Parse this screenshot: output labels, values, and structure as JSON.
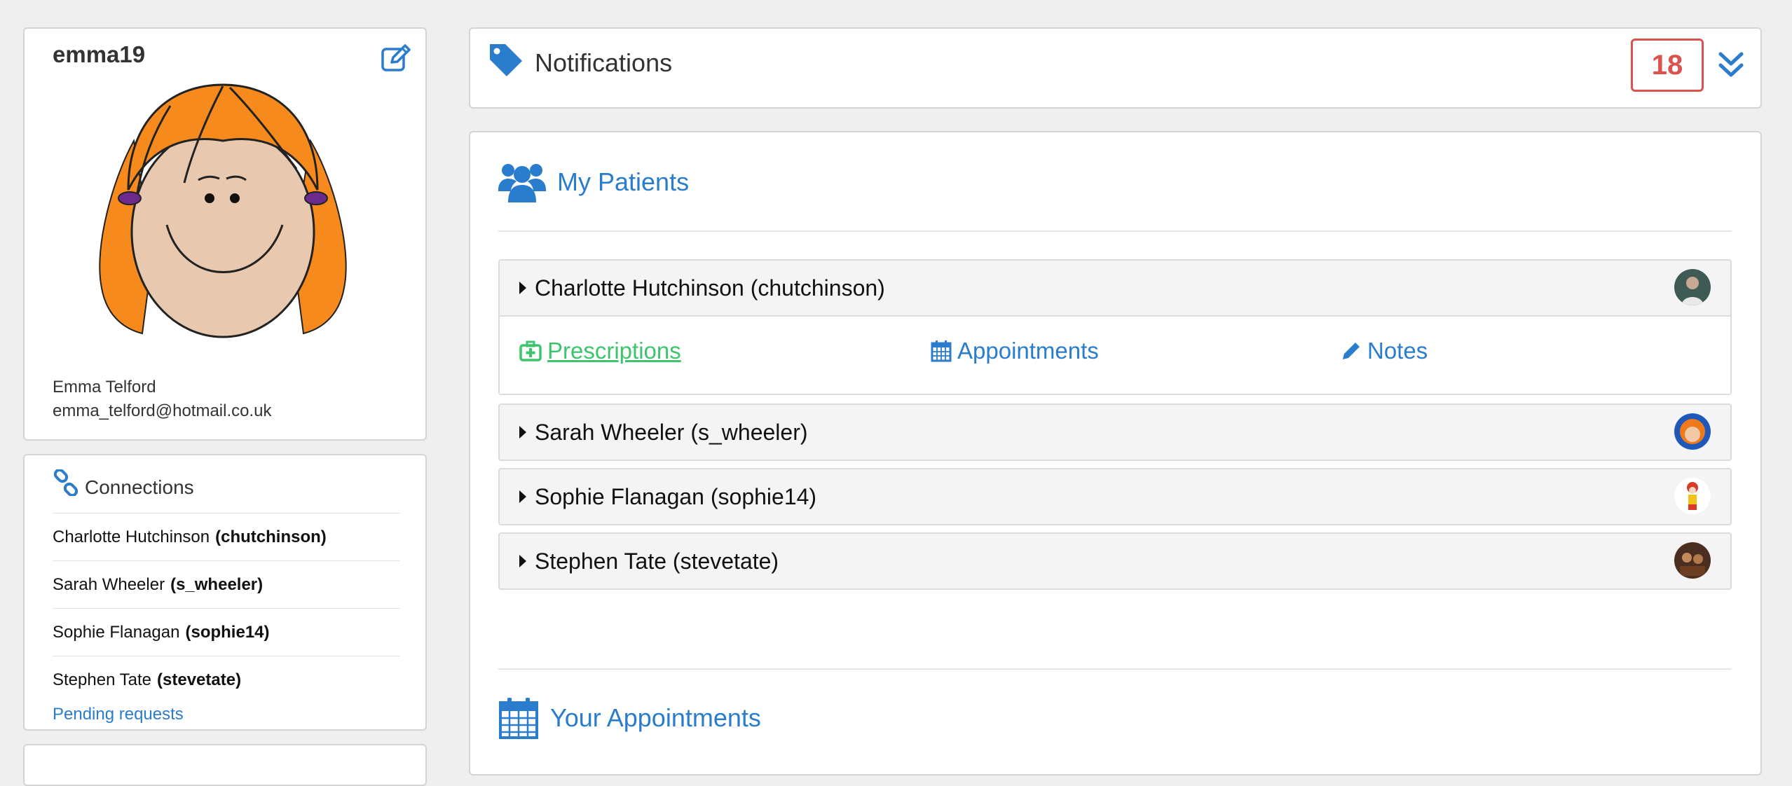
{
  "profile": {
    "username": "emma19",
    "full_name": "Emma Telford",
    "email": "emma_telford@hotmail.co.uk",
    "edit_icon": "edit-icon"
  },
  "connections": {
    "title": "Connections",
    "items": [
      {
        "name": "Charlotte Hutchinson",
        "handle": "(chutchinson)"
      },
      {
        "name": "Sarah Wheeler",
        "handle": "(s_wheeler)"
      },
      {
        "name": "Sophie Flanagan",
        "handle": "(sophie14)"
      },
      {
        "name": "Stephen Tate",
        "handle": "(stevetate)"
      }
    ],
    "pending_label": "Pending requests"
  },
  "notifications": {
    "title": "Notifications",
    "count": "18"
  },
  "patients": {
    "title": "My Patients",
    "items": [
      {
        "label": "Charlotte Hutchinson (chutchinson)"
      },
      {
        "label": "Sarah Wheeler (s_wheeler)"
      },
      {
        "label": "Sophie Flanagan (sophie14)"
      },
      {
        "label": "Stephen Tate (stevetate)"
      }
    ],
    "actions": {
      "prescriptions": "Prescriptions",
      "appointments": "Appointments",
      "notes": "Notes"
    }
  },
  "appointments": {
    "title": "Your Appointments"
  },
  "colors": {
    "accent": "#2a7ccc",
    "success": "#3ec46d",
    "danger": "#d9534f"
  }
}
